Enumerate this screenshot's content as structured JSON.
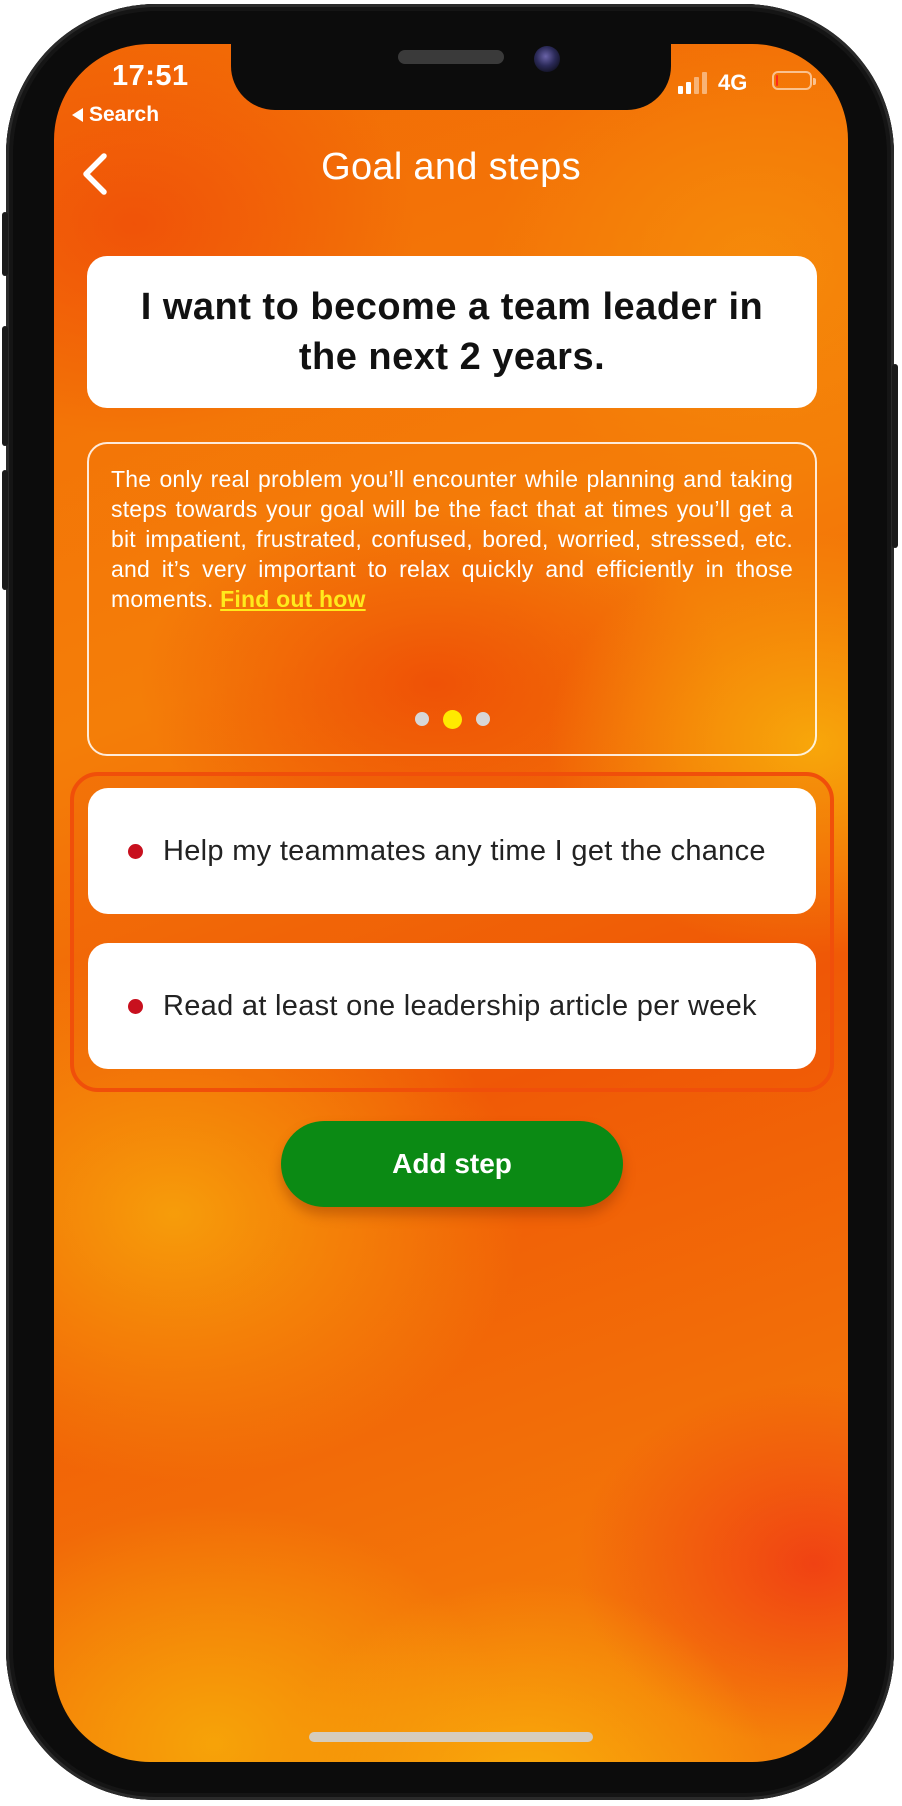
{
  "status_bar": {
    "time": "17:51",
    "back_app_label": "Search",
    "network": "4G",
    "signal_bars": 2,
    "signal_bars_total": 4,
    "battery_level": 0.05
  },
  "header": {
    "title": "Goal and steps",
    "back_icon": "chevron-left-icon"
  },
  "goal": {
    "text": "I want to become a team leader in the next 2 years."
  },
  "tip": {
    "text": "The only real problem you’ll encounter while planning and taking steps towards your goal will be the fact that at times you’ll get a bit impatient, frustrated, confused, bored, worried, stressed, etc. and it’s very important to relax quickly and efficiently in those moments.",
    "link_text": "Find out how",
    "pager": {
      "count": 3,
      "active_index": 1
    }
  },
  "steps": [
    {
      "text": "Help my teammates any time I get the chance"
    },
    {
      "text": "Read at least one leadership article per week"
    }
  ],
  "actions": {
    "add_step_label": "Add step"
  },
  "colors": {
    "accent_orange": "#f26a06",
    "step_bullet": "#c8101e",
    "add_button": "#0b8a14",
    "link_yellow": "#ffea1c",
    "pager_active": "#ffea00",
    "pager_inactive": "#d7d7d7"
  }
}
